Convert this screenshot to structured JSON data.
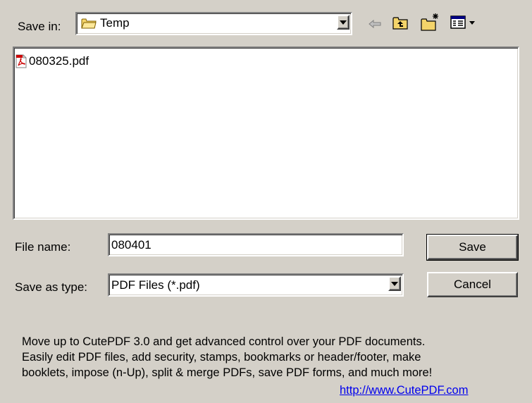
{
  "save_in": {
    "label": "Save in:",
    "folder_name": "Temp",
    "folder_icon": "folder-icon"
  },
  "toolbar": {
    "back_icon": "back-arrow-icon",
    "up_folder_icon": "up-one-level-icon",
    "new_folder_icon": "new-folder-icon",
    "view_menu_icon": "view-menu-icon"
  },
  "file_list": {
    "items": [
      {
        "name": "080325.pdf",
        "icon": "pdf-file-icon"
      }
    ]
  },
  "file_name": {
    "label": "File name:",
    "value": "080401"
  },
  "save_as_type": {
    "label": "Save as type:",
    "value": "PDF Files (*.pdf)"
  },
  "buttons": {
    "save": "Save",
    "cancel": "Cancel"
  },
  "promo": {
    "line1": "Move up to CutePDF 3.0 and get advanced control over your PDF documents.",
    "line2": "Easily edit PDF files, add security, stamps, bookmarks or header/footer, make",
    "line3": "booklets, impose (n-Up), split & merge PDFs, save PDF forms, and much more!",
    "link": "http://www.CutePDF.com"
  },
  "colors": {
    "dialog_bg": "#d4d0c8",
    "link": "#0000ee",
    "pdf_red": "#cc0000",
    "folder_yellow": "#f4d46a"
  }
}
